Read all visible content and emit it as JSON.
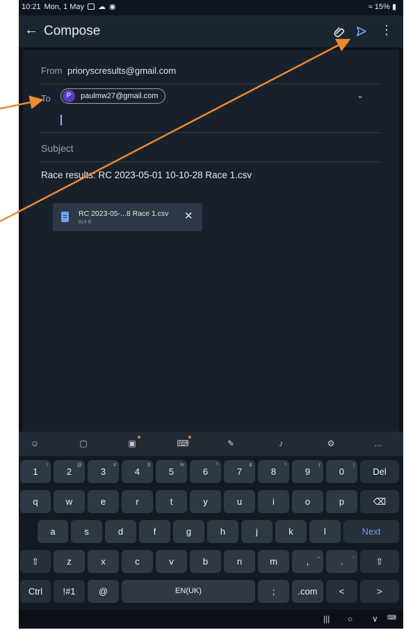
{
  "status_bar": {
    "time": "10:21",
    "date": "Mon, 1 May",
    "battery": "15%"
  },
  "app_bar": {
    "back_icon": "arrow-back-icon",
    "title": "Compose",
    "attach_icon": "paperclip-icon",
    "send_icon": "send-icon",
    "more_icon": "more-vert-icon"
  },
  "compose": {
    "from_label": "From",
    "from_value": "prioryscresults@gmail.com",
    "to_label": "To",
    "recipient": {
      "initial": "P",
      "email": "paulmw27@gmail.com",
      "avatar_color": "#5b3fbd"
    },
    "subject_label": "Subject",
    "body": "Race results: RC 2023-05-01 10-10-28 Race 1.csv",
    "attachment": {
      "name": "RC 2023-05-...8 Race 1.csv",
      "size": "814 B"
    }
  },
  "keyboard": {
    "row1": [
      {
        "label": "1",
        "sup": "!"
      },
      {
        "label": "2",
        "sup": "@"
      },
      {
        "label": "3",
        "sup": "#"
      },
      {
        "label": "4",
        "sup": "$"
      },
      {
        "label": "5",
        "sup": "%"
      },
      {
        "label": "6",
        "sup": "^"
      },
      {
        "label": "7",
        "sup": "&"
      },
      {
        "label": "8",
        "sup": "*"
      },
      {
        "label": "9",
        "sup": "("
      },
      {
        "label": "0",
        "sup": ")"
      },
      {
        "label": "Del",
        "sup": ""
      }
    ],
    "row2": [
      "q",
      "w",
      "e",
      "r",
      "t",
      "y",
      "u",
      "i",
      "o",
      "p",
      "⌫"
    ],
    "row3": [
      "a",
      "s",
      "d",
      "f",
      "g",
      "h",
      "j",
      "k",
      "l",
      "Next"
    ],
    "row4": [
      "⇧",
      "z",
      "x",
      "c",
      "v",
      "b",
      "n",
      "m",
      ",",
      ".",
      " ⇧"
    ],
    "row5": {
      "ctrl": "Ctrl",
      "sym": "!#1",
      "at": "@",
      "space": "EN(UK)",
      "semicolon": ";",
      "com": ".com",
      "left": "<",
      "right": ">"
    },
    "row4_subs": {
      "comma": "–",
      "period": "-"
    }
  },
  "colors": {
    "accent": "#7ba6e8",
    "annotation_arrow": "#ee8a2e"
  }
}
